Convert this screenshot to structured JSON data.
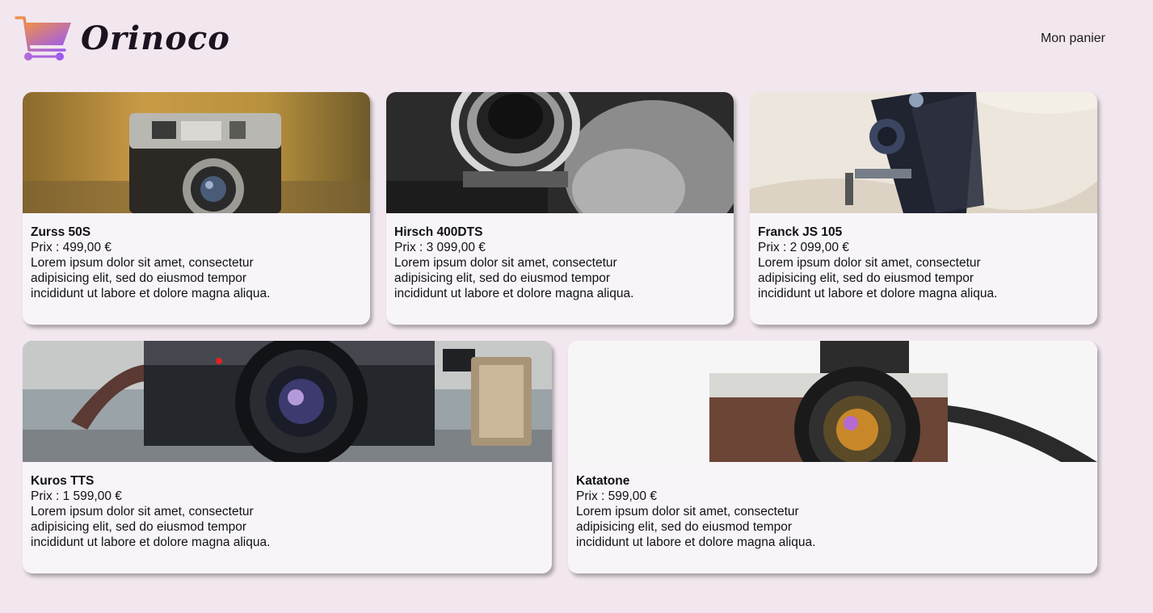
{
  "header": {
    "brand": "Orinoco",
    "cart_link": "Mon panier"
  },
  "colors": {
    "background": "#f2e7ef",
    "card": "#f8f5fa",
    "logo_gradient_start": "#f0904a",
    "logo_gradient_end": "#9b5bf0"
  },
  "products": [
    {
      "name": "Zurss 50S",
      "price": "Prix : 499,00 €",
      "description": "Lorem ipsum dolor sit amet, consectetur adipisicing elit, sed do eiusmod tempor incididunt ut labore et dolore magna aliqua."
    },
    {
      "name": "Hirsch 400DTS",
      "price": "Prix : 3 099,00 €",
      "description": "Lorem ipsum dolor sit amet, consectetur adipisicing elit, sed do eiusmod tempor incididunt ut labore et dolore magna aliqua."
    },
    {
      "name": "Franck JS 105",
      "price": "Prix : 2 099,00 €",
      "description": "Lorem ipsum dolor sit amet, consectetur adipisicing elit, sed do eiusmod tempor incididunt ut labore et dolore magna aliqua."
    },
    {
      "name": "Kuros TTS",
      "price": "Prix : 1 599,00 €",
      "description": "Lorem ipsum dolor sit amet, consectetur adipisicing elit, sed do eiusmod tempor incididunt ut labore et dolore magna aliqua."
    },
    {
      "name": "Katatone",
      "price": "Prix : 599,00 €",
      "description": "Lorem ipsum dolor sit amet, consectetur adipisicing elit, sed do eiusmod tempor incididunt ut labore et dolore magna aliqua."
    }
  ]
}
